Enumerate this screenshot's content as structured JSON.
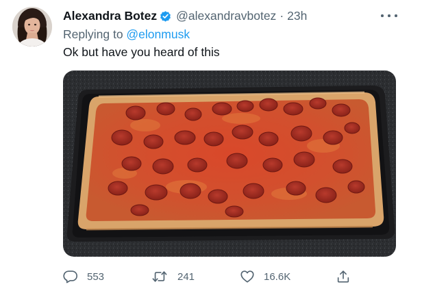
{
  "author": {
    "display_name": "Alexandra Botez",
    "handle": "@alexandravbotez",
    "separator": "·",
    "time": "23h",
    "verified": true
  },
  "reply_context": {
    "prefix": "Replying to ",
    "mention": "@elonmusk"
  },
  "body": {
    "text": "Ok but have you heard of this"
  },
  "media": {
    "description_icon": "pizza-photo"
  },
  "actions": {
    "reply_count": "553",
    "retweet_count": "241",
    "like_count": "16.6K"
  },
  "colors": {
    "text_primary": "#0f1419",
    "text_secondary": "#536471",
    "accent": "#1d9bf0"
  }
}
